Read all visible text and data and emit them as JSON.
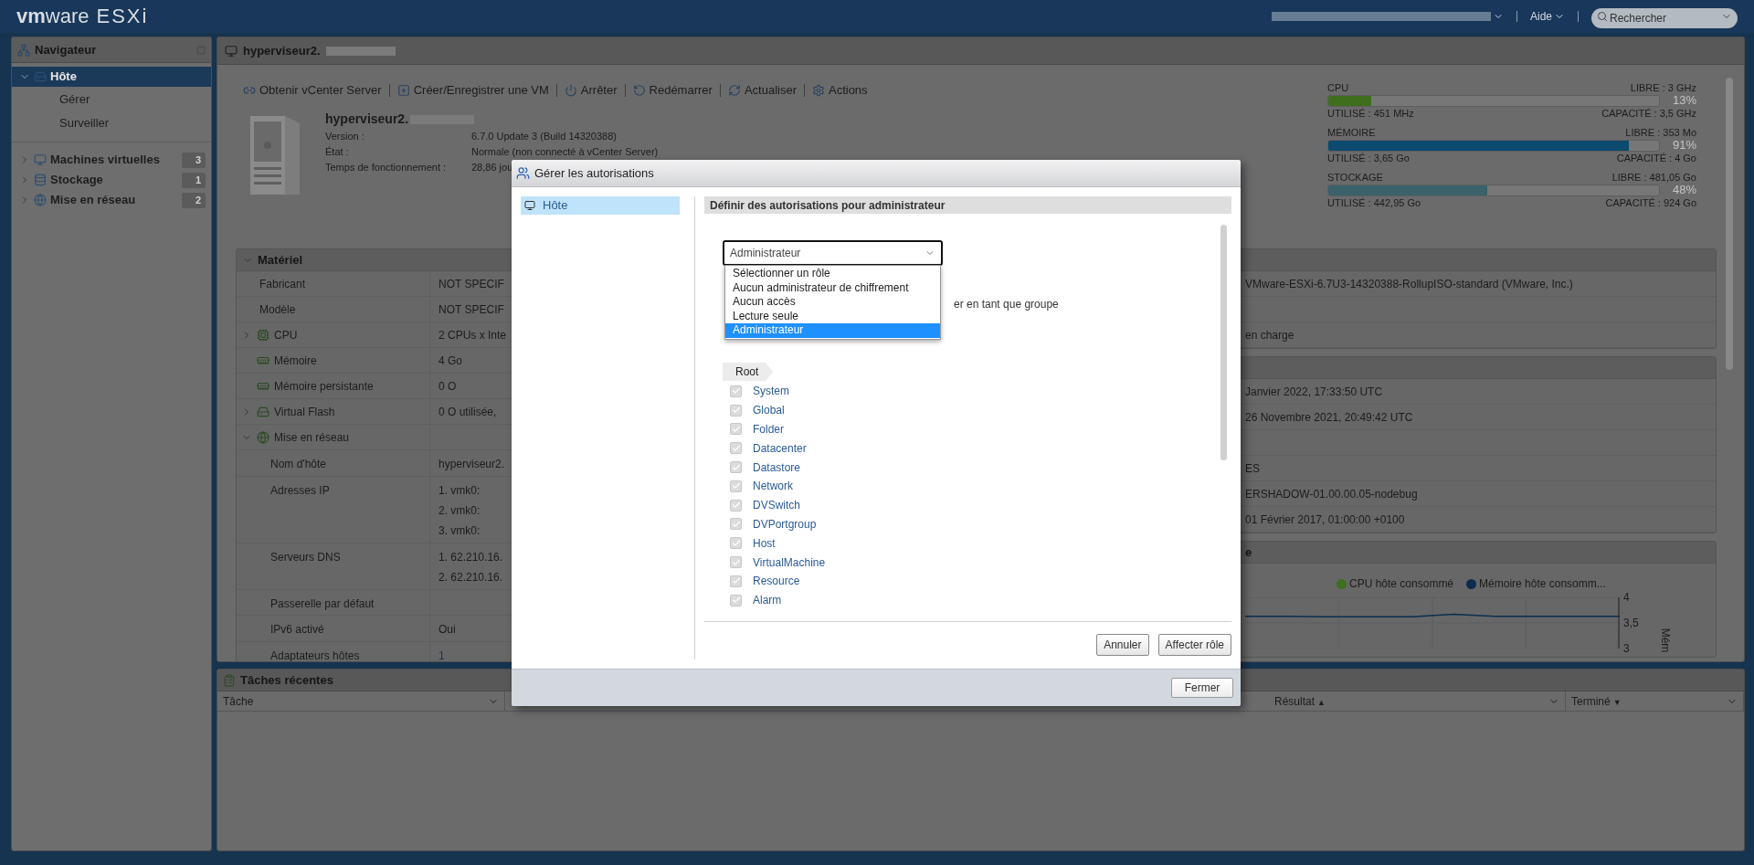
{
  "topbar": {
    "logo_vm": "vm",
    "logo_ware": "ware",
    "product": "ESXi",
    "help": "Aide",
    "search": {
      "placeholder": "Rechercher"
    }
  },
  "navigator": {
    "title": "Navigateur",
    "items": [
      {
        "label": "Hôte",
        "selected": true,
        "expanded": true,
        "children": [
          {
            "label": "Gérer",
            "selected": false
          },
          {
            "label": "Surveiller",
            "selected": false
          }
        ]
      },
      {
        "label": "Machines virtuelles",
        "selected": false,
        "expanded": false,
        "count": "3"
      },
      {
        "label": "Stockage",
        "selected": false,
        "expanded": false,
        "count": "1"
      },
      {
        "label": "Mise en réseau",
        "selected": false,
        "expanded": false,
        "count": "2"
      }
    ]
  },
  "host": {
    "title": "hyperviseur2.",
    "toolbar": [
      "Obtenir vCenter Server",
      "Créer/Enregistrer une VM",
      "Arrêter",
      "Redémarrer",
      "Actualiser",
      "Actions"
    ],
    "name": "hyperviseur2.",
    "info": [
      {
        "label": "Version :",
        "value": "6.7.0 Update 3 (Build 14320388)"
      },
      {
        "label": "État :",
        "value": "Normale (non connecté à vCenter Server)"
      },
      {
        "label": "Temps de fonctionnement :",
        "value": "28,86 jou"
      }
    ]
  },
  "resources": [
    {
      "name": "CPU",
      "free": "LIBRE : 3 GHz",
      "level": 0.13,
      "percent": "13%",
      "used": "UTILISÉ : 451 MHz",
      "capacity": "CAPACITÉ : 3,5 GHz",
      "color": "#3f6e1f"
    },
    {
      "name": "MÉMOIRE",
      "free": "LIBRE : 353 Mo",
      "level": 0.91,
      "percent": "91%",
      "used": "UTILISÉ : 3,65 Go",
      "capacity": "CAPACITÉ : 4 Go",
      "color": "#0c4a6e"
    },
    {
      "name": "STOCKAGE",
      "free": "LIBRE : 481,05 Go",
      "level": 0.48,
      "percent": "48%",
      "used": "UTILISÉ : 442,95 Go",
      "capacity": "CAPACITÉ : 924 Go",
      "color": "#3b616b"
    }
  ],
  "hardware": {
    "title": "Matériel",
    "expanded": true,
    "rows": [
      {
        "kind": "plain",
        "label": "Fabricant",
        "value": "NOT SPECIF"
      },
      {
        "kind": "plain",
        "label": "Modèle",
        "value": "NOT SPECIF"
      },
      {
        "kind": "icon",
        "label": "CPU",
        "value": "2 CPUs x Inte",
        "expanded": false
      },
      {
        "kind": "icon",
        "label": "Mémoire",
        "value": "4 Go"
      },
      {
        "kind": "icon",
        "label": "Mémoire persistante",
        "value": "0 O"
      },
      {
        "kind": "icon",
        "label": "Virtual Flash",
        "value": "0 O utilisée,",
        "expanded": false
      },
      {
        "kind": "icon",
        "label": "Mise en réseau",
        "expanded": true,
        "children": [
          {
            "label": "Nom d'hôte",
            "values": [
              "hyperviseur2."
            ]
          },
          {
            "label": "Adresses IP",
            "values": [
              "1. vmk0:",
              "2. vmk0:",
              "3. vmk0:"
            ]
          },
          {
            "label": "Serveurs DNS",
            "values": [
              "1. 62.210.16.",
              "2. 62.210.16."
            ]
          },
          {
            "label": "Passerelle par défaut"
          },
          {
            "label": "IPv6 activé",
            "values": [
              "Oui"
            ]
          },
          {
            "label": "Adaptateurs hôtes",
            "values": [
              "1"
            ],
            "link": true
          }
        ]
      }
    ]
  },
  "configuration": {
    "rows": [
      {
        "value": "VMware-ESXi-6.7U3-14320388-RollupISO-standard (VMware, Inc.)"
      },
      {},
      {
        "value": "en charge"
      }
    ]
  },
  "system_info": {
    "rows": [
      {
        "value": "Janvier 2022, 17:33:50 UTC"
      },
      {
        "value": "26 Novembre 2021, 20:49:42 UTC"
      },
      {},
      {
        "value": "ES"
      },
      {
        "value": "ERSHADOW-01.00.00.05-nodebug"
      },
      {
        "value": "01 Février 2017, 01:00:00 +0100"
      }
    ]
  },
  "performance": {
    "title": "e",
    "chart_data": {
      "type": "line",
      "ylabel": "Mém",
      "ylim": [
        3,
        4
      ],
      "yticks": [
        {
          "value": 4,
          "label": "4"
        },
        {
          "value": 3.5,
          "label": "3,5"
        },
        {
          "value": 3,
          "label": "3"
        }
      ],
      "series": [
        {
          "name": "CPU hôte consommé",
          "color": "#3f6e1f",
          "values": [
            null,
            null,
            null,
            null,
            null,
            null,
            null,
            null,
            null,
            null
          ]
        },
        {
          "name": "Mémoire hôte consomm...",
          "color": "#0b2d4f",
          "values": [
            3.63,
            3.63,
            3.62,
            3.62,
            3.62,
            3.67,
            3.63,
            3.63,
            3.63,
            3.63
          ]
        }
      ]
    }
  },
  "recent_tasks": {
    "title": "Tâches récentes",
    "columns": [
      {
        "label": "Tâche"
      },
      {
        "label": "Résultat",
        "sort": "▲"
      },
      {
        "label": "Terminé",
        "sort": "▼"
      }
    ]
  },
  "dialog": {
    "title": "Gérer les autorisations",
    "sidebar": [
      {
        "label": "Hôte",
        "selected": true
      }
    ],
    "heading": "Définir des autorisations pour administrateur",
    "role_select": {
      "value": "Administrateur",
      "expanded": true,
      "options": [
        {
          "label": "Sélectionner un rôle",
          "selected": false
        },
        {
          "label": "Aucun administrateur de chiffrement",
          "selected": false
        },
        {
          "label": "Aucun accès",
          "selected": false
        },
        {
          "label": "Lecture seule",
          "selected": false
        },
        {
          "label": "Administrateur",
          "selected": true
        }
      ]
    },
    "group_option_label": "er en tant que groupe",
    "breadcrumb": "Root",
    "privileges": [
      {
        "label": "System",
        "checked": true
      },
      {
        "label": "Global",
        "checked": true
      },
      {
        "label": "Folder",
        "checked": true
      },
      {
        "label": "Datacenter",
        "checked": true
      },
      {
        "label": "Datastore",
        "checked": true
      },
      {
        "label": "Network",
        "checked": true
      },
      {
        "label": "DVSwitch",
        "checked": true
      },
      {
        "label": "DVPortgroup",
        "checked": true
      },
      {
        "label": "Host",
        "checked": true
      },
      {
        "label": "VirtualMachine",
        "checked": true
      },
      {
        "label": "Resource",
        "checked": true
      },
      {
        "label": "Alarm",
        "checked": true
      }
    ],
    "buttons": [
      "Annuler",
      "Affecter rôle"
    ],
    "footer_button": "Fermer"
  }
}
